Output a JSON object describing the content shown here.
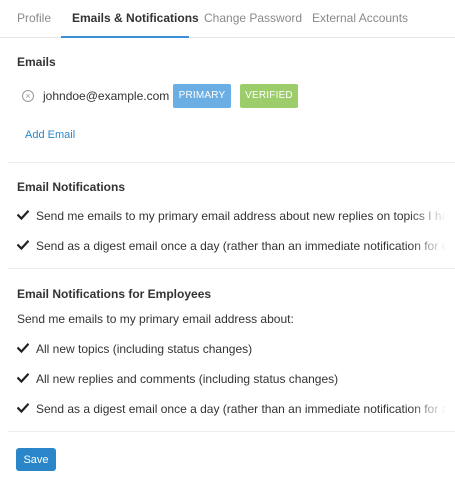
{
  "tabs": [
    {
      "label": "Profile",
      "active": false
    },
    {
      "label": "Emails & Notifications",
      "active": true
    },
    {
      "label": "Change Password",
      "active": false
    },
    {
      "label": "External Accounts",
      "active": false
    }
  ],
  "colors": {
    "accent": "#2a86c8",
    "primary_badge": "#6aaee3",
    "verified_badge": "#9ccd6a"
  },
  "emails": {
    "title": "Emails",
    "address": "johndoe@example.com",
    "primary_badge": "PRIMARY",
    "verified_badge": "VERIFIED",
    "add_email": "Add Email"
  },
  "notifications": {
    "title": "Email Notifications",
    "items": [
      {
        "label": "Send me emails to my primary email address about new replies on topics I have",
        "checked": true
      },
      {
        "label": "Send as a digest email once a day (rather than an immediate notification for e",
        "checked": true
      }
    ]
  },
  "employees": {
    "title": "Email Notifications for Employees",
    "intro": "Send me emails to my primary email address about:",
    "items": [
      {
        "label": "All new topics (including status changes)",
        "checked": true
      },
      {
        "label": "All new replies and comments (including status changes)",
        "checked": true
      },
      {
        "label": "Send as a digest email once a day (rather than an immediate notification for a",
        "checked": true
      }
    ]
  },
  "save_label": "Save"
}
